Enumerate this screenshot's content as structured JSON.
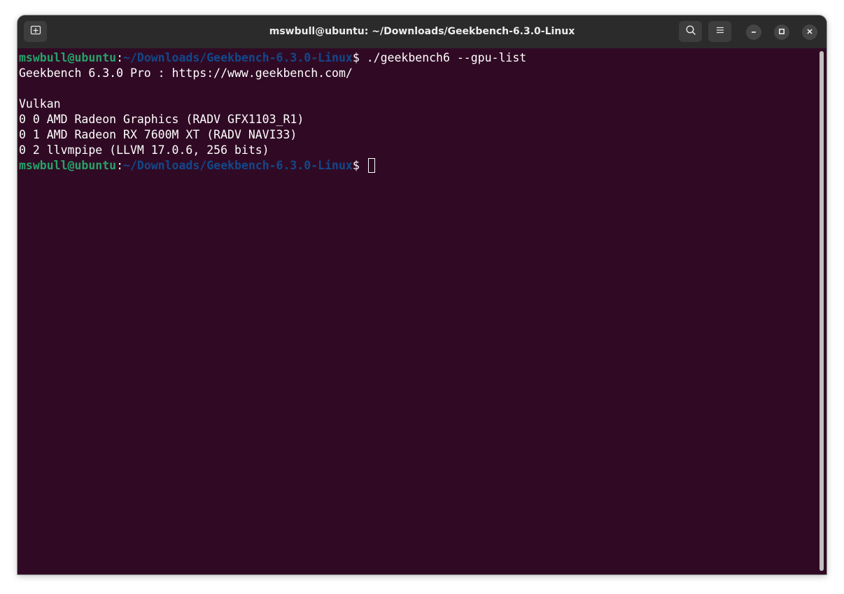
{
  "window": {
    "title": "mswbull@ubuntu: ~/Downloads/Geekbench-6.3.0-Linux"
  },
  "titlebar": {
    "new_tab_icon": "new-tab-icon",
    "search_icon": "search-icon",
    "menu_icon": "hamburger-menu-icon",
    "minimize_icon": "minimize-icon",
    "maximize_icon": "maximize-icon",
    "close_icon": "close-icon"
  },
  "colors": {
    "terminal_background": "#300a24",
    "prompt_user": "#26a269",
    "prompt_path": "#12488b",
    "text": "#ffffff",
    "titlebar": "#2b2b2b"
  },
  "terminal": {
    "prompt1": {
      "user": "mswbull@ubuntu",
      "sep": ":",
      "path": "~/Downloads/Geekbench-6.3.0-Linux",
      "symbol": "$ ",
      "command": "./geekbench6 --gpu-list"
    },
    "output": [
      "Geekbench 6.3.0 Pro : https://www.geekbench.com/",
      "",
      "Vulkan",
      "0 0 AMD Radeon Graphics (RADV GFX1103_R1)",
      "0 1 AMD Radeon RX 7600M XT (RADV NAVI33)",
      "0 2 llvmpipe (LLVM 17.0.6, 256 bits)"
    ],
    "prompt2": {
      "user": "mswbull@ubuntu",
      "sep": ":",
      "path": "~/Downloads/Geekbench-6.3.0-Linux",
      "symbol": "$ "
    }
  }
}
